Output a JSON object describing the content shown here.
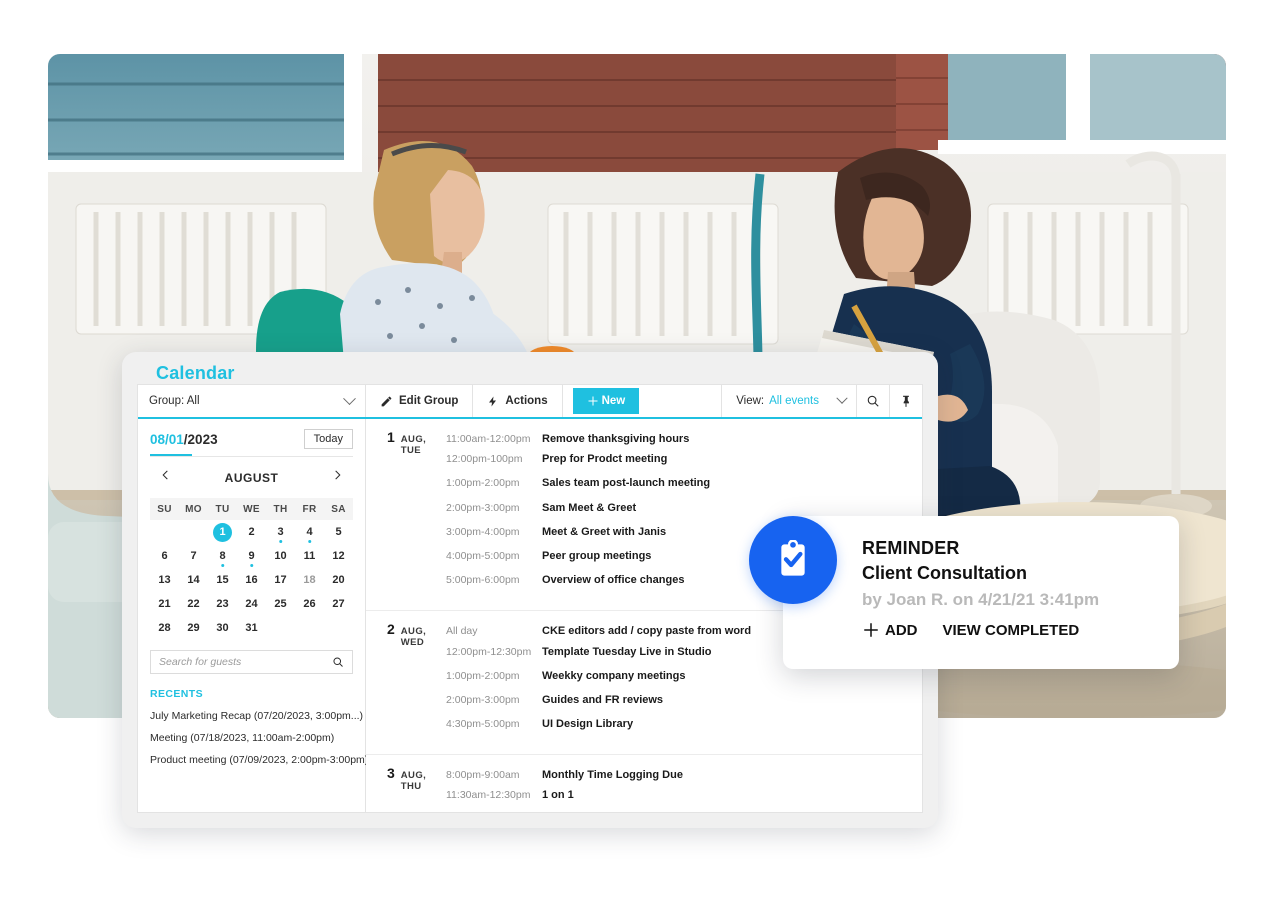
{
  "app": {
    "title": "Calendar",
    "accent_teal": "#1fc0e0",
    "accent_blue": "#1763f0"
  },
  "toolbar": {
    "group_label": "Group: All",
    "edit_group_label": "Edit Group",
    "actions_label": "Actions",
    "new_label": "New",
    "view_prefix": "View:",
    "view_value": "All events",
    "search_icon": "search-icon",
    "pin_icon": "pin-icon"
  },
  "sidebar": {
    "date_month_day": "08/01",
    "date_year": "/2023",
    "today_label": "Today",
    "month_label": "AUGUST",
    "prev_icon": "chevron-left-icon",
    "next_icon": "chevron-right-icon",
    "weekdays": [
      "SU",
      "MO",
      "TU",
      "WE",
      "TH",
      "FR",
      "SA"
    ],
    "days": [
      {
        "label": "",
        "empty": true
      },
      {
        "label": "",
        "empty": true
      },
      {
        "label": "1",
        "selected": true
      },
      {
        "label": "2"
      },
      {
        "label": "3",
        "dot": true
      },
      {
        "label": "4",
        "dot": true
      },
      {
        "label": "5"
      },
      {
        "label": "6"
      },
      {
        "label": "7"
      },
      {
        "label": "8",
        "dot": true
      },
      {
        "label": "9",
        "dot": true
      },
      {
        "label": "10"
      },
      {
        "label": "11"
      },
      {
        "label": "12"
      },
      {
        "label": "13"
      },
      {
        "label": "14"
      },
      {
        "label": "15"
      },
      {
        "label": "16"
      },
      {
        "label": "17"
      },
      {
        "label": "18",
        "muted": true
      },
      {
        "label": "20"
      },
      {
        "label": "21"
      },
      {
        "label": "22"
      },
      {
        "label": "23"
      },
      {
        "label": "24"
      },
      {
        "label": "25"
      },
      {
        "label": "26"
      },
      {
        "label": "27"
      },
      {
        "label": "28"
      },
      {
        "label": "29"
      },
      {
        "label": "30"
      },
      {
        "label": "31"
      },
      {
        "label": "",
        "empty": true
      },
      {
        "label": "",
        "empty": true
      },
      {
        "label": "",
        "empty": true
      }
    ],
    "guest_search_placeholder": "Search for guests",
    "guest_search_value": "",
    "guest_search_icon": "search-icon",
    "recents_heading": "RECENTS",
    "recents": [
      "July Marketing Recap (07/20/2023, 3:00pm...)",
      "Meeting (07/18/2023, 11:00am-2:00pm)",
      "Product meeting (07/09/2023, 2:00pm-3:00pm)"
    ]
  },
  "events": [
    {
      "day_number": "1",
      "day_name": "AUG, TUE",
      "items": [
        {
          "time": "11:00am-12:00pm",
          "title": "Remove thanksgiving hours"
        },
        {
          "time": "12:00pm-100pm",
          "title": "Prep for Prodct meeting"
        },
        {
          "time": "1:00pm-2:00pm",
          "title": "Sales team post-launch meeting"
        },
        {
          "time": "2:00pm-3:00pm",
          "title": "Sam Meet & Greet"
        },
        {
          "time": "3:00pm-4:00pm",
          "title": "Meet & Greet with Janis"
        },
        {
          "time": "4:00pm-5:00pm",
          "title": "Peer group meetings"
        },
        {
          "time": "5:00pm-6:00pm",
          "title": "Overview of office changes"
        }
      ]
    },
    {
      "day_number": "2",
      "day_name": "AUG, WED",
      "items": [
        {
          "time": "All day",
          "title": "CKE editors add / copy paste from word"
        },
        {
          "time": "12:00pm-12:30pm",
          "title": "Template Tuesday Live in Studio"
        },
        {
          "time": "1:00pm-2:00pm",
          "title": "Weekky company meetings"
        },
        {
          "time": "2:00pm-3:00pm",
          "title": "Guides and FR reviews"
        },
        {
          "time": "4:30pm-5:00pm",
          "title": "UI Design Library"
        }
      ]
    },
    {
      "day_number": "3",
      "day_name": "AUG, THU",
      "items": [
        {
          "time": "8:00pm-9:00am",
          "title": "Monthly Time Logging Due"
        },
        {
          "time": "11:30am-12:30pm",
          "title": "1 on 1"
        }
      ]
    }
  ],
  "reminder": {
    "icon": "clipboard-check-icon",
    "kicker": "REMINDER",
    "title": "Client Consultation",
    "byline": "by Joan R. on 4/21/21 3:41pm",
    "add_label": "ADD",
    "view_completed_label": "VIEW COMPLETED"
  }
}
